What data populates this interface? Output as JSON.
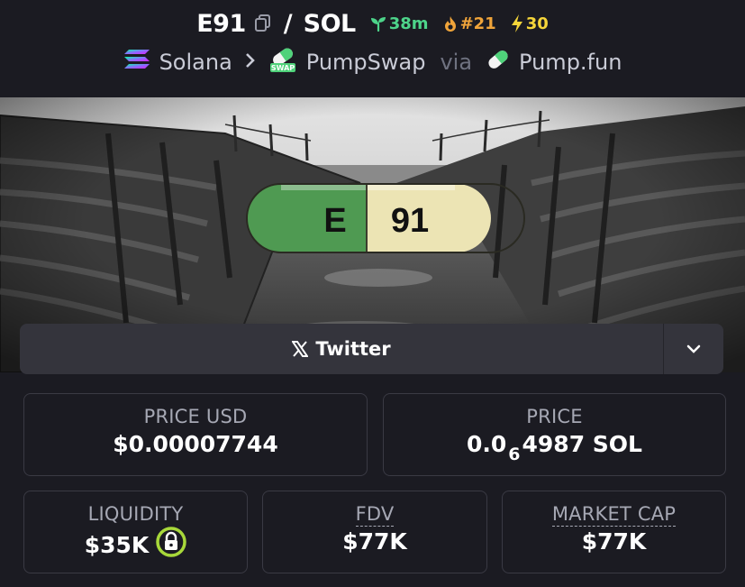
{
  "header": {
    "symbol": "E91",
    "quote": "SOL",
    "age": "38m",
    "rank": "#21",
    "boosts": "30",
    "chain": "Solana",
    "dex": "PumpSwap",
    "dex_badge": "SWAP",
    "via": "via",
    "launchpad": "Pump.fun"
  },
  "banner": {
    "pill_left": "E",
    "pill_right": "91"
  },
  "links": {
    "twitter_label": "Twitter"
  },
  "stats": {
    "price_usd_label": "PRICE USD",
    "price_usd_value": "$0.00007744",
    "price_label": "PRICE",
    "price_prefix": "0.0",
    "price_zeros": "6",
    "price_suffix": "4987 SOL",
    "liquidity_label": "LIQUIDITY",
    "liquidity_value": "$35K",
    "fdv_label": "FDV",
    "fdv_value": "$77K",
    "mcap_label": "MARKET CAP",
    "mcap_value": "$77K"
  },
  "colors": {
    "background": "#1b1b22",
    "age_green": "#4dd48a",
    "rank_orange": "#f0a43a",
    "boost_yellow": "#f5d53a",
    "pill_green": "#4f9a52",
    "pill_cream": "#ece4b4",
    "lock_ring": "#a8d83a"
  }
}
